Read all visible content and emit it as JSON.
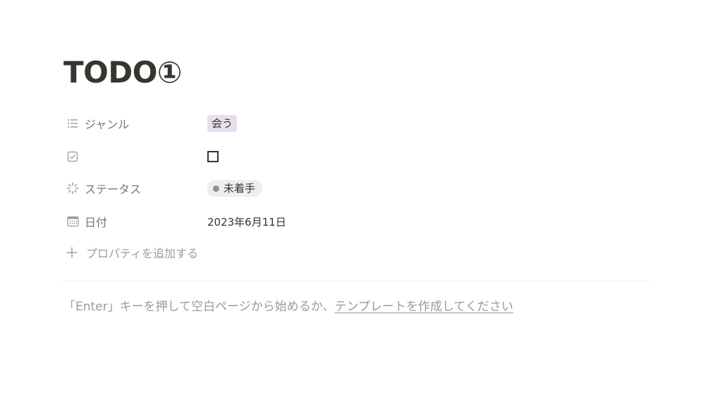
{
  "page": {
    "title": "TODO①"
  },
  "properties": [
    {
      "name": "ジャンル",
      "icon": "list-icon",
      "value": "会う",
      "value_type": "tag",
      "tag_color": "#e8deee"
    },
    {
      "name": "",
      "icon": "checkbox-icon",
      "value": "",
      "value_type": "checkbox",
      "checked": false
    },
    {
      "name": "ステータス",
      "icon": "status-icon",
      "value": "未着手",
      "value_type": "status",
      "status_color": "#91918e"
    },
    {
      "name": "日付",
      "icon": "calendar-icon",
      "value": "2023年6月11日",
      "value_type": "date"
    }
  ],
  "add_property": {
    "label": "プロパティを追加する",
    "icon": "plus-icon"
  },
  "empty_hint": {
    "prefix": "「Enter」キーを押して空白ページから始めるか、",
    "link": "テンプレートを作成してください"
  }
}
